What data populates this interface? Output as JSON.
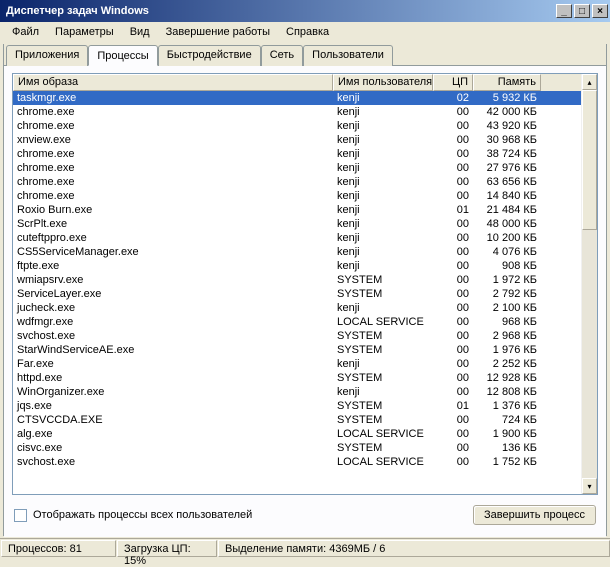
{
  "window": {
    "title": "Диспетчер задач Windows"
  },
  "menu": {
    "file": "Файл",
    "options": "Параметры",
    "view": "Вид",
    "shutdown": "Завершение работы",
    "help": "Справка"
  },
  "tabs": {
    "applications": "Приложения",
    "processes": "Процессы",
    "performance": "Быстродействие",
    "networking": "Сеть",
    "users": "Пользователи"
  },
  "columns": {
    "image_name": "Имя образа",
    "user_name": "Имя пользователя",
    "cpu": "ЦП",
    "memory": "Память"
  },
  "processes": [
    {
      "name": "taskmgr.exe",
      "user": "kenji",
      "cpu": "02",
      "mem": "5 932 КБ",
      "selected": true
    },
    {
      "name": "chrome.exe",
      "user": "kenji",
      "cpu": "00",
      "mem": "42 000 КБ"
    },
    {
      "name": "chrome.exe",
      "user": "kenji",
      "cpu": "00",
      "mem": "43 920 КБ"
    },
    {
      "name": "xnview.exe",
      "user": "kenji",
      "cpu": "00",
      "mem": "30 968 КБ"
    },
    {
      "name": "chrome.exe",
      "user": "kenji",
      "cpu": "00",
      "mem": "38 724 КБ"
    },
    {
      "name": "chrome.exe",
      "user": "kenji",
      "cpu": "00",
      "mem": "27 976 КБ"
    },
    {
      "name": "chrome.exe",
      "user": "kenji",
      "cpu": "00",
      "mem": "63 656 КБ"
    },
    {
      "name": "chrome.exe",
      "user": "kenji",
      "cpu": "00",
      "mem": "14 840 КБ"
    },
    {
      "name": "Roxio Burn.exe",
      "user": "kenji",
      "cpu": "01",
      "mem": "21 484 КБ"
    },
    {
      "name": "ScrPlt.exe",
      "user": "kenji",
      "cpu": "00",
      "mem": "48 000 КБ"
    },
    {
      "name": "cuteftppro.exe",
      "user": "kenji",
      "cpu": "00",
      "mem": "10 200 КБ"
    },
    {
      "name": "CS5ServiceManager.exe",
      "user": "kenji",
      "cpu": "00",
      "mem": "4 076 КБ"
    },
    {
      "name": "ftpte.exe",
      "user": "kenji",
      "cpu": "00",
      "mem": "908 КБ"
    },
    {
      "name": "wmiapsrv.exe",
      "user": "SYSTEM",
      "cpu": "00",
      "mem": "1 972 КБ"
    },
    {
      "name": "ServiceLayer.exe",
      "user": "SYSTEM",
      "cpu": "00",
      "mem": "2 792 КБ"
    },
    {
      "name": "jucheck.exe",
      "user": "kenji",
      "cpu": "00",
      "mem": "2 100 КБ"
    },
    {
      "name": "wdfmgr.exe",
      "user": "LOCAL SERVICE",
      "cpu": "00",
      "mem": "968 КБ"
    },
    {
      "name": "svchost.exe",
      "user": "SYSTEM",
      "cpu": "00",
      "mem": "2 968 КБ"
    },
    {
      "name": "StarWindServiceAE.exe",
      "user": "SYSTEM",
      "cpu": "00",
      "mem": "1 976 КБ"
    },
    {
      "name": "Far.exe",
      "user": "kenji",
      "cpu": "00",
      "mem": "2 252 КБ"
    },
    {
      "name": "httpd.exe",
      "user": "SYSTEM",
      "cpu": "00",
      "mem": "12 928 КБ"
    },
    {
      "name": "WinOrganizer.exe",
      "user": "kenji",
      "cpu": "00",
      "mem": "12 808 КБ"
    },
    {
      "name": "jqs.exe",
      "user": "SYSTEM",
      "cpu": "01",
      "mem": "1 376 КБ"
    },
    {
      "name": "CTSVCCDA.EXE",
      "user": "SYSTEM",
      "cpu": "00",
      "mem": "724 КБ"
    },
    {
      "name": "alg.exe",
      "user": "LOCAL SERVICE",
      "cpu": "00",
      "mem": "1 900 КБ"
    },
    {
      "name": "cisvc.exe",
      "user": "SYSTEM",
      "cpu": "00",
      "mem": "136 КБ"
    },
    {
      "name": "svchost.exe",
      "user": "LOCAL SERVICE",
      "cpu": "00",
      "mem": "1 752 КБ"
    }
  ],
  "controls": {
    "show_all_users": "Отображать процессы всех пользователей",
    "end_process": "Завершить процесс"
  },
  "status": {
    "processes_label": "Процессов:",
    "processes_value": "81",
    "cpu_label": "Загрузка ЦП:",
    "cpu_value": "15%",
    "mem_label": "Выделение памяти:",
    "mem_value": "4369МБ / 6"
  }
}
